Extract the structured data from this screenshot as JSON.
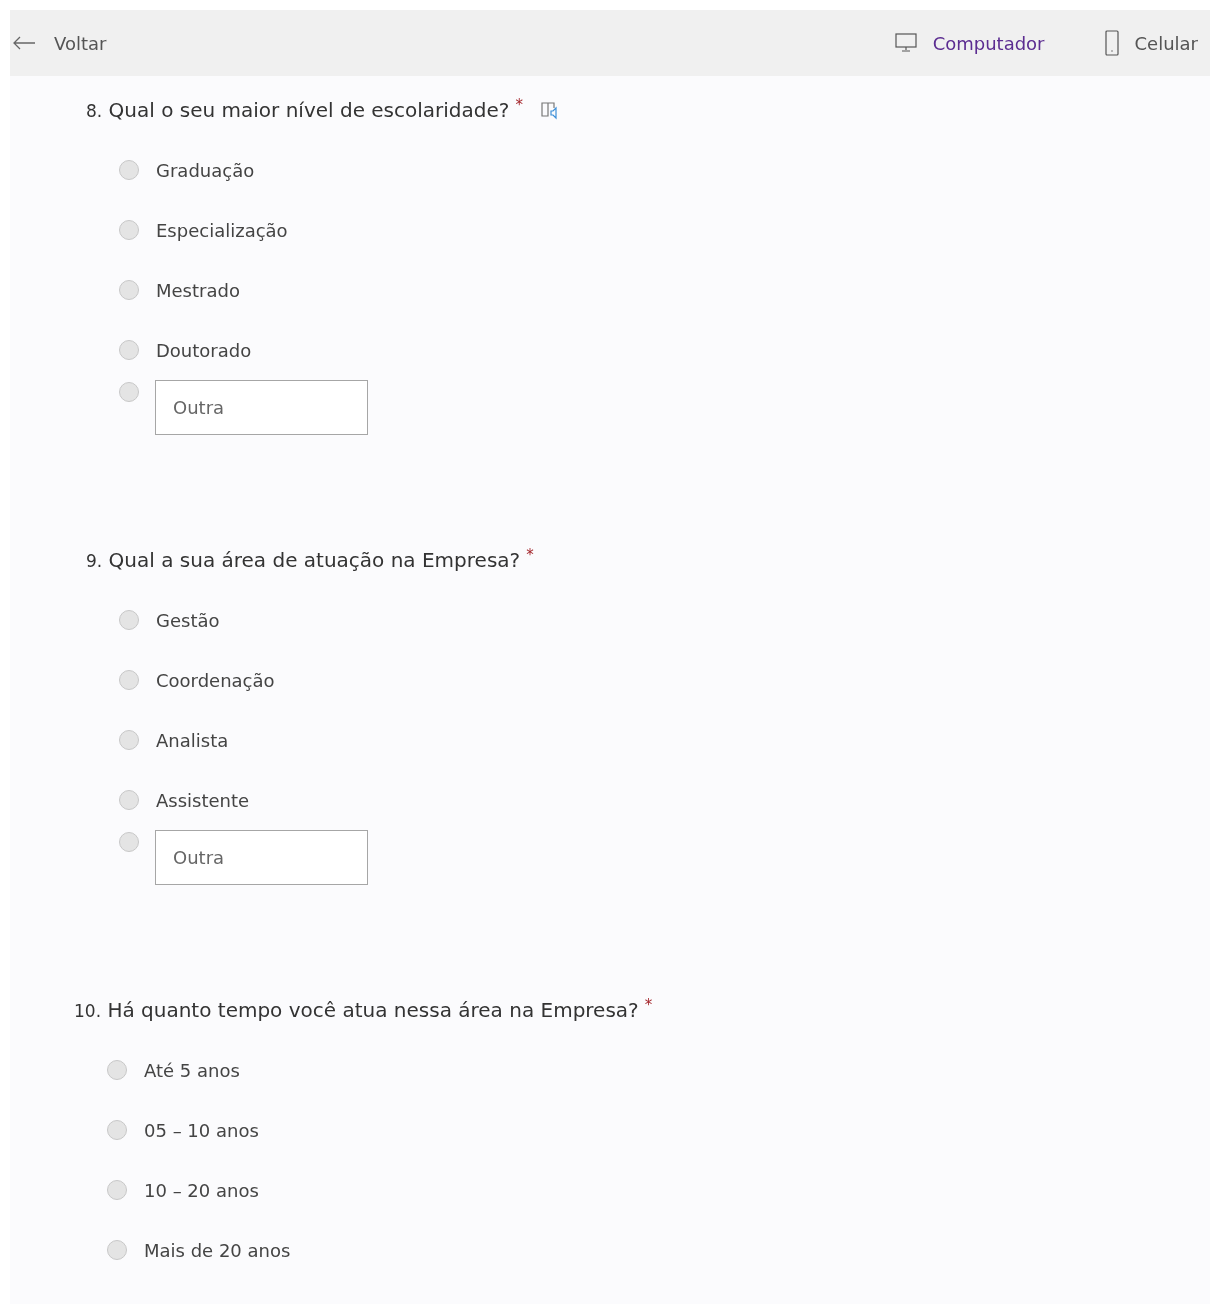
{
  "toolbar": {
    "back": "Voltar",
    "views": [
      {
        "kind": "desktop",
        "label": "Computador"
      },
      {
        "kind": "phone",
        "label": "Celular"
      }
    ]
  },
  "questions": [
    {
      "number": "8.",
      "title": "Qual o seu maior nível de escolaridade?",
      "required_mark": "*",
      "reader_button": true,
      "options": [
        {
          "kind": "option",
          "label": "Graduação",
          "selected": false
        },
        {
          "kind": "option",
          "label": "Especialização",
          "selected": false
        },
        {
          "kind": "option",
          "label": "Mestrado",
          "selected": false
        },
        {
          "kind": "option",
          "label": "Doutorado",
          "selected": false
        },
        {
          "kind": "other",
          "placeholder": "Outra",
          "selected": false
        }
      ]
    },
    {
      "number": "9.",
      "title": "Qual a sua área de atuação na Empresa?",
      "required_mark": "*",
      "reader_button": false,
      "options": [
        {
          "kind": "option",
          "label": "Gestão",
          "selected": false
        },
        {
          "kind": "option",
          "label": "Coordenação",
          "selected": false
        },
        {
          "kind": "option",
          "label": "Analista",
          "selected": false
        },
        {
          "kind": "option",
          "label": "Assistente",
          "selected": false
        },
        {
          "kind": "other",
          "placeholder": "Outra",
          "selected": false
        }
      ]
    },
    {
      "number": "10.",
      "title": "Há quanto tempo você atua nessa área na Empresa?",
      "required_mark": "*",
      "reader_button": false,
      "options": [
        {
          "kind": "option",
          "label": "Até 5 anos",
          "selected": false
        },
        {
          "kind": "option",
          "label": "05 – 10 anos",
          "selected": false
        },
        {
          "kind": "option",
          "label": "10 – 20 anos",
          "selected": false
        },
        {
          "kind": "option",
          "label": "Mais de 20 anos",
          "selected": false
        }
      ]
    }
  ]
}
